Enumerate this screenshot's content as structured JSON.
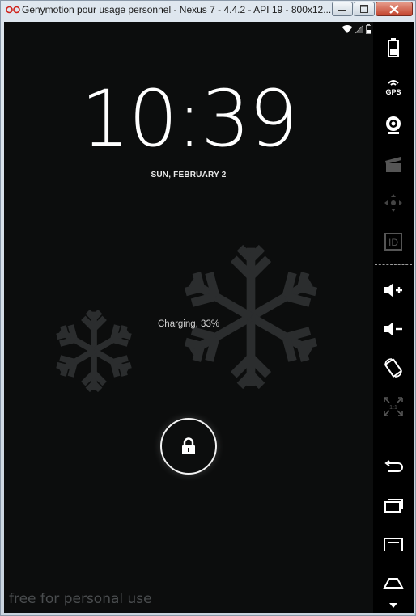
{
  "window": {
    "title": "Genymotion pour usage personnel - Nexus 7 - 4.4.2 - API 19 - 800x12..."
  },
  "lockscreen": {
    "time": "10:39",
    "date": "SUN, FEBRUARY 2",
    "charging_status": "Charging, 33%",
    "watermark": "free for personal use"
  },
  "toolbar": {
    "gps_label": "GPS",
    "id_label": "ID",
    "pixel_perfect_label": "1:1",
    "items": [
      "battery",
      "gps",
      "webcam",
      "screencast",
      "remote-control",
      "device-id",
      "volume-up",
      "volume-down",
      "rotate",
      "pixel-perfect",
      "back",
      "recent-apps",
      "menu",
      "home"
    ]
  },
  "colors": {
    "screen_bg": "#0c0d0d",
    "snowflake": "#2b2d2e",
    "text": "#ffffff"
  }
}
